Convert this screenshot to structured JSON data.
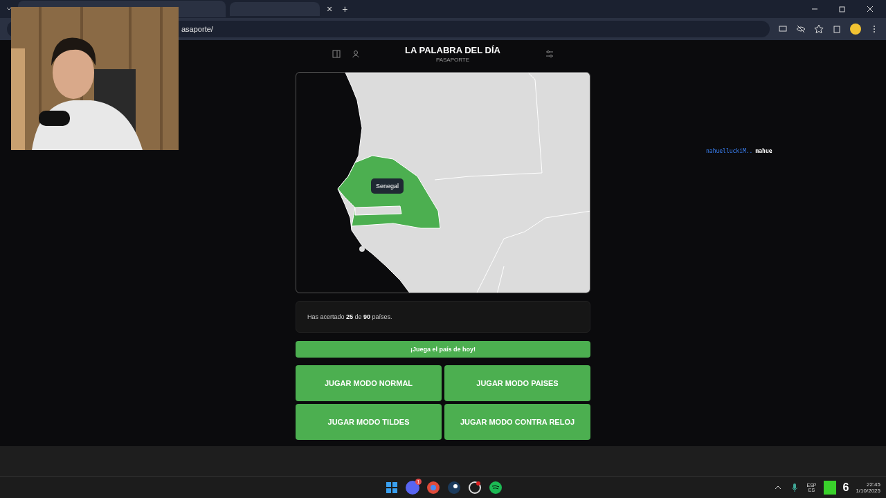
{
  "browser": {
    "url": "asaporte/",
    "tab_close": "×",
    "new_tab": "+"
  },
  "header": {
    "title": "LA PALABRA DEL DÍA",
    "subtitle": "PASAPORTE"
  },
  "map": {
    "tooltip": "Senegal"
  },
  "stats": {
    "text": "Has acertado **25** de **90** países."
  },
  "daily_button": "¡Juega el país de hoy!",
  "modes": [
    "JUGAR MODO NORMAL",
    "JUGAR MODO PAISES",
    "JUGAR MODO TILDES",
    "JUGAR MODO CONTRA RELOJ"
  ],
  "overlay": {
    "user": "nahuelluckiM..",
    "text": "mahue"
  },
  "taskbar": {
    "discord_badge": "1",
    "lang": "ESP",
    "layout": "ES",
    "counter": "6",
    "time": "22:45",
    "date": "1/10/2025"
  }
}
